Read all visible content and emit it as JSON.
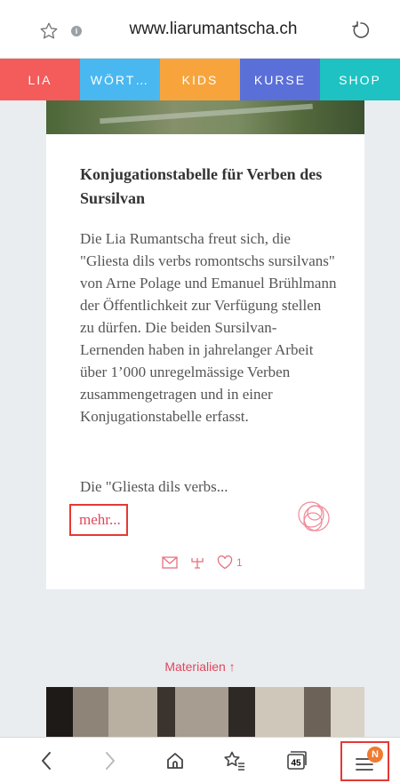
{
  "browser": {
    "url": "www.liarumantscha.ch",
    "info_glyph": "i",
    "tabs_count": "45",
    "menu_badge": "N"
  },
  "nav": {
    "items": [
      {
        "label": "LIA",
        "color": "#f45b5b"
      },
      {
        "label": "WÖRT…",
        "color": "#49b8f0"
      },
      {
        "label": "KIDS",
        "color": "#f7a43c"
      },
      {
        "label": "KURSE",
        "color": "#5a6fd8"
      },
      {
        "label": "SHOP",
        "color": "#1ec2c2"
      }
    ]
  },
  "article": {
    "title": "Konjugationstabelle für Verben des Sursilvan",
    "body": "Die Lia Rumantscha freut sich, die \"Gliesta dils verbs romontschs sursilvans\" von Arne Polage und Emanuel Brühlmann der Öffentlichkeit zur Verfügung stellen zu dürfen. Die beiden Sursilvan-Lernenden haben in jahrelanger Arbeit über 1’000 unregelmässige Verben zusammengetragen und in einer Konjugationstabelle erfasst.",
    "excerpt": "Die \"Gliesta dils verbs...",
    "more_label": "mehr...",
    "like_count": "1"
  },
  "section": {
    "materialien_label": "Materialien ↑"
  },
  "colors": {
    "accent": "#e2465b",
    "highlight_border": "#e53935"
  }
}
